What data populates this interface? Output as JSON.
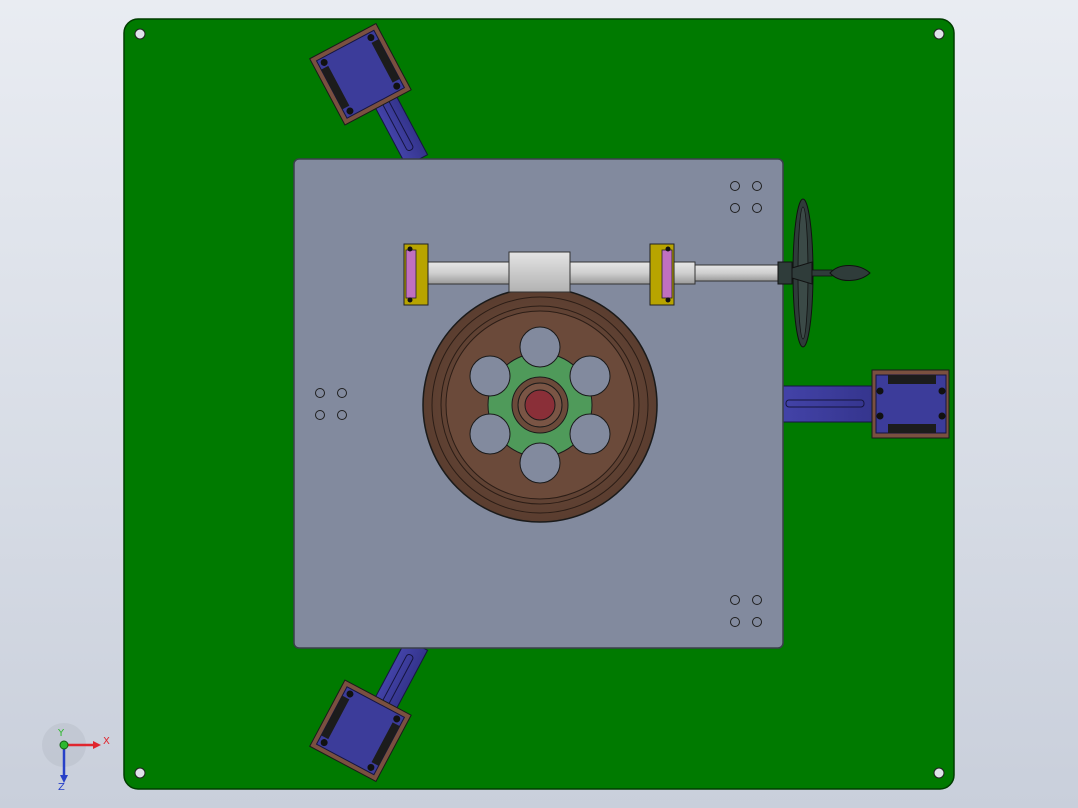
{
  "viewport": {
    "background_top": "#e9ecf2",
    "background_bottom": "#c9cfdb"
  },
  "model": {
    "base_plate_color": "#007a00",
    "top_plate_color": "#828a9e",
    "bracket_color": "#3c3c9a",
    "wheel_color": "#6b4a3a",
    "wheel_window_color": "#4f9a5a",
    "hub_color": "#8a2f38",
    "shaft_color": "#c9c9c9",
    "bearing_color": "#b8a400",
    "handwheel_color": "#2f3c3a",
    "icons": [
      "base-plate-icon",
      "top-plate-icon",
      "bracket-icon",
      "pulley-wheel-icon",
      "shaft-icon",
      "handwheel-icon"
    ]
  },
  "triad": {
    "x_label": "X",
    "y_label": "Y",
    "z_label": "Z",
    "x_color": "#e0262e",
    "y_color": "#2eb82e",
    "z_color": "#2740c8"
  }
}
